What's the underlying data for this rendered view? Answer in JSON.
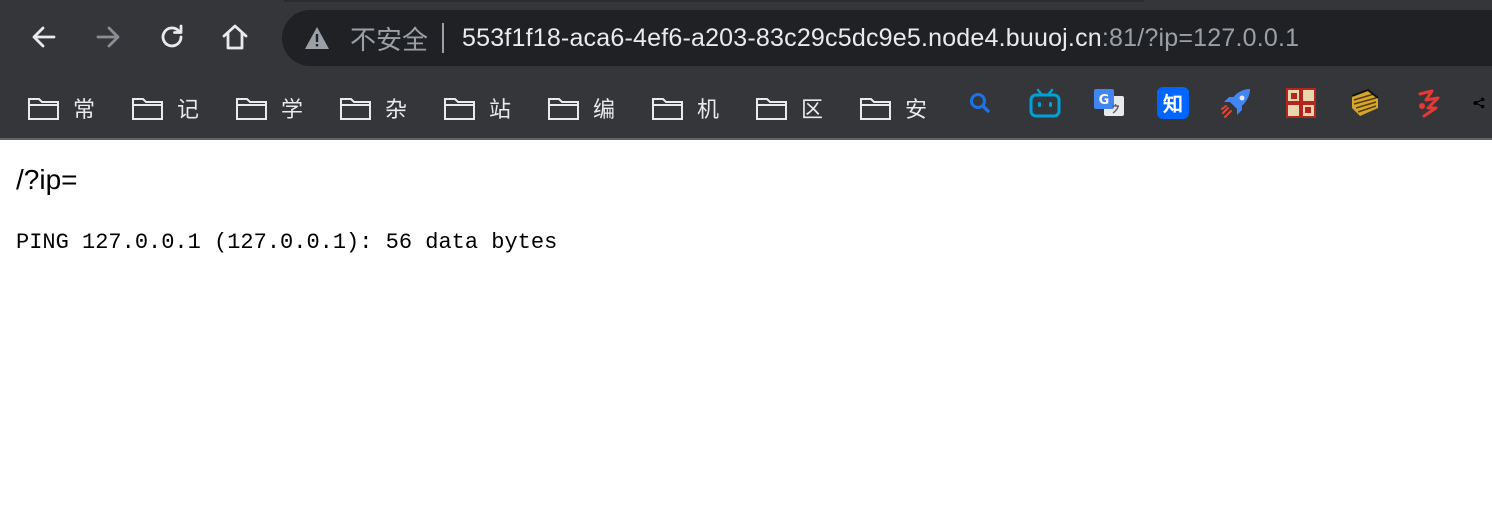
{
  "browser": {
    "insecure_label": "不安全",
    "url_host": "553f1f18-aca6-4ef6-a203-83c29c5dc9e5.node4.buuoj.cn",
    "url_rest": ":81/?ip=127.0.0.1"
  },
  "bookmarks": {
    "folders": [
      {
        "label": "常"
      },
      {
        "label": "记"
      },
      {
        "label": "学"
      },
      {
        "label": "杂"
      },
      {
        "label": "站"
      },
      {
        "label": "编"
      },
      {
        "label": "机"
      },
      {
        "label": "区"
      },
      {
        "label": "安"
      }
    ],
    "icons": [
      "search-icon",
      "bilibili-icon",
      "google-translate-icon",
      "zhihu-icon",
      "rocket-icon",
      "shield-crest-icon",
      "ship-icon",
      "red-glyph-icon",
      "share-icon"
    ],
    "zhihu_text": "知"
  },
  "page": {
    "heading": "/?ip=",
    "ping_output": "PING 127.0.0.1 (127.0.0.1): 56 data bytes"
  }
}
